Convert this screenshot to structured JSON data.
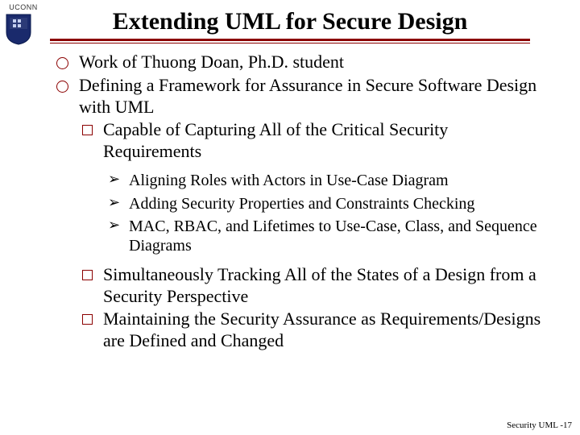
{
  "logo": {
    "org": "UCONN"
  },
  "title": "Extending UML for Secure Design",
  "bullets": {
    "b1": "Work of Thuong Doan, Ph.D. student",
    "b2": "Defining a Framework for Assurance in Secure Software Design with UML",
    "b2_1": "Capable of Capturing All of the Critical Security Requirements",
    "b2_1_a": "Aligning Roles with Actors in Use-Case Diagram",
    "b2_1_b": "Adding Security Properties and Constraints Checking",
    "b2_1_c": "MAC, RBAC, and Lifetimes to Use-Case, Class, and Sequence Diagrams",
    "b2_2": "Simultaneously Tracking All of the States of a Design from a Security Perspective",
    "b2_3": "Maintaining the Security Assurance as Requirements/Designs are Defined and Changed"
  },
  "footer": "Security UML -17"
}
